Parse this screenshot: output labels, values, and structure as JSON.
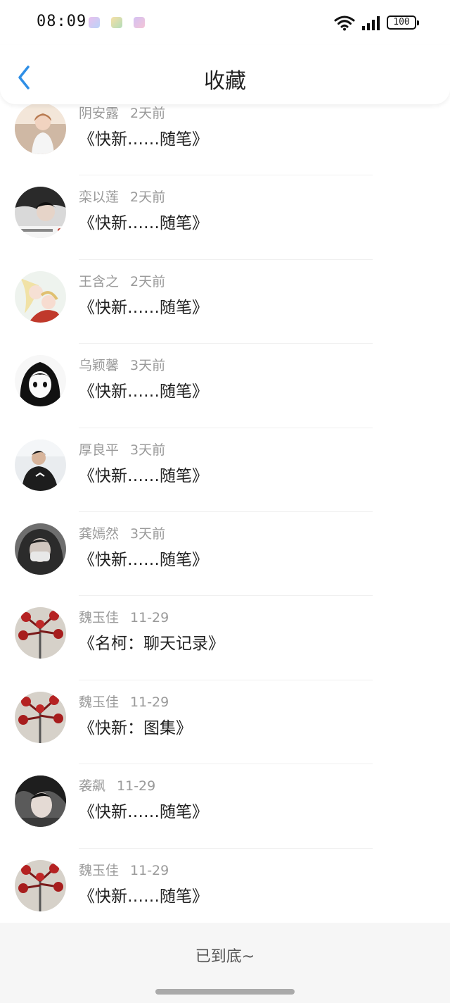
{
  "status_bar": {
    "time": "08:09",
    "battery": "100",
    "icons": [
      "wifi-icon",
      "signal-icon",
      "battery-icon"
    ]
  },
  "header": {
    "title": "收藏",
    "back_icon": "chevron-left-icon"
  },
  "colors": {
    "accent": "#2f8fe6",
    "meta_text": "#9a9a9a",
    "title_text": "#222222",
    "footer_bg": "#f6f6f6"
  },
  "items": [
    {
      "name": "阴安露",
      "date": "2天前",
      "title": "《快新……随笔》"
    },
    {
      "name": "栾以莲",
      "date": "2天前",
      "title": "《快新……随笔》"
    },
    {
      "name": "王含之",
      "date": "2天前",
      "title": "《快新……随笔》"
    },
    {
      "name": "乌颖馨",
      "date": "3天前",
      "title": "《快新……随笔》"
    },
    {
      "name": "厚良平",
      "date": "3天前",
      "title": "《快新……随笔》"
    },
    {
      "name": "龚嫣然",
      "date": "3天前",
      "title": "《快新……随笔》"
    },
    {
      "name": "魏玉佳",
      "date": "11-29",
      "title": "《名柯：聊天记录》"
    },
    {
      "name": "魏玉佳",
      "date": "11-29",
      "title": "《快新：图集》"
    },
    {
      "name": "袭飙",
      "date": "11-29",
      "title": "《快新……随笔》"
    },
    {
      "name": "魏玉佳",
      "date": "11-29",
      "title": "《快新……随笔》"
    }
  ],
  "footer": {
    "end_text": "已到底~"
  }
}
